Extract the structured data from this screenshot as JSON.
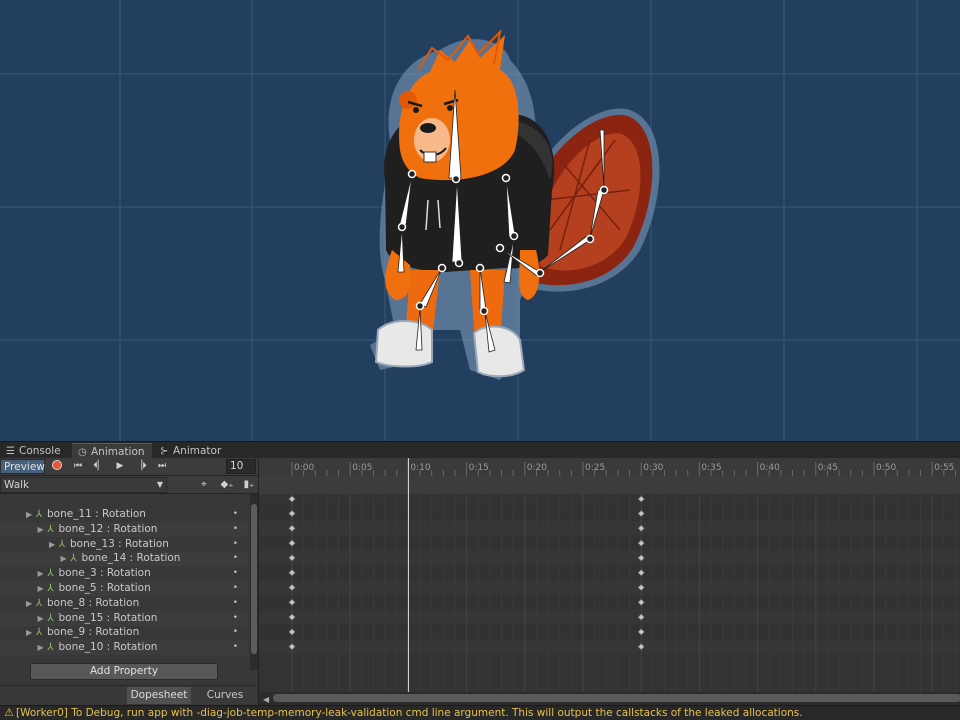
{
  "tabs": [
    {
      "label": "Console",
      "icon": "list-icon"
    },
    {
      "label": "Animation",
      "icon": "clock-icon"
    },
    {
      "label": "Animator",
      "icon": "graph-icon"
    }
  ],
  "controls": {
    "preview_label": "Preview",
    "frame": "10",
    "clip": "Walk"
  },
  "properties": [
    {
      "label": "bone_11 : Rotation",
      "indent": 0
    },
    {
      "label": "bone_12 : Rotation",
      "indent": 1
    },
    {
      "label": "bone_13 : Rotation",
      "indent": 2
    },
    {
      "label": "bone_14 : Rotation",
      "indent": 3
    },
    {
      "label": "bone_3 : Rotation",
      "indent": 1
    },
    {
      "label": "bone_5 : Rotation",
      "indent": 1
    },
    {
      "label": "bone_8 : Rotation",
      "indent": 0
    },
    {
      "label": "bone_15 : Rotation",
      "indent": 1
    },
    {
      "label": "bone_9 : Rotation",
      "indent": 0
    },
    {
      "label": "bone_10 : Rotation",
      "indent": 1
    }
  ],
  "add_property_label": "Add Property",
  "bottom_tabs": {
    "dopesheet": "Dopesheet",
    "curves": "Curves"
  },
  "timeline": {
    "ticks": [
      "0:00",
      "0:05",
      "0:10",
      "0:15",
      "0:20",
      "0:25",
      "0:30",
      "0:35",
      "0:40",
      "0:45",
      "0:50",
      "0:55"
    ],
    "playhead_frame": 10,
    "keyframe_times": [
      "0:00",
      "0:30"
    ]
  },
  "status_message": "[Worker0] To Debug, run app with -diag-job-temp-memory-leak-validation cmd line argument. This will output the callstacks of the leaked allocations.",
  "colors": {
    "scene_bg": "#233f60",
    "record": "#e5533d",
    "warning": "#e6c24a"
  }
}
